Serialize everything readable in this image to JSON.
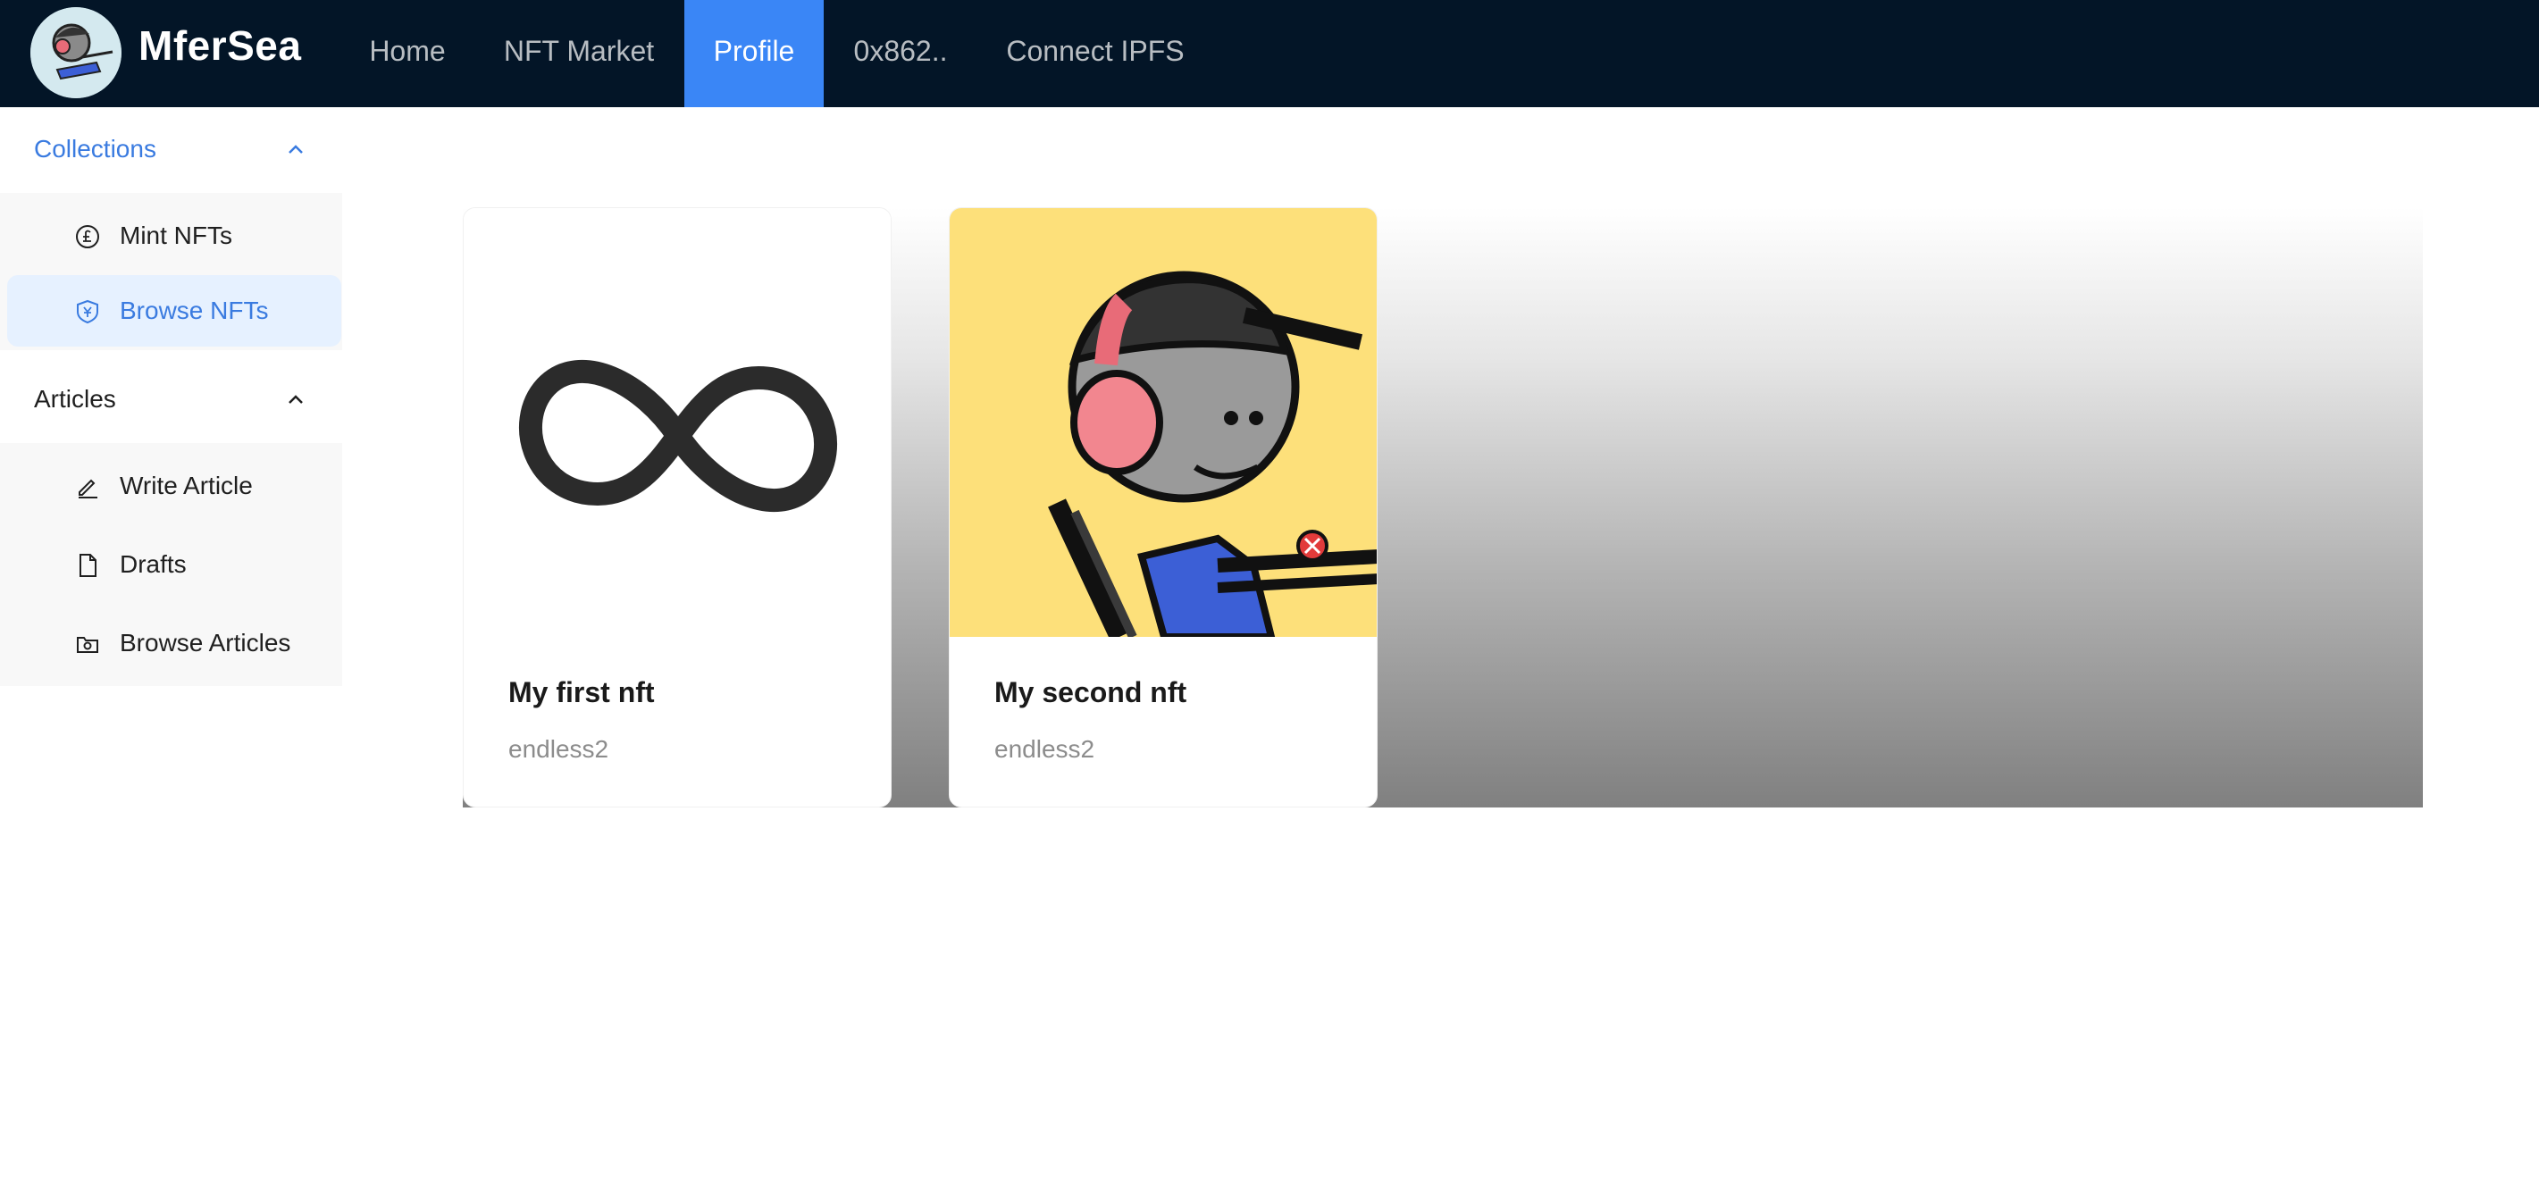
{
  "header": {
    "brand": "MferSea",
    "nav": [
      {
        "label": "Home"
      },
      {
        "label": "NFT Market"
      },
      {
        "label": "Profile"
      },
      {
        "label": "0x862.."
      },
      {
        "label": "Connect IPFS"
      }
    ],
    "active_index": 2
  },
  "sidebar": {
    "collections": {
      "label": "Collections",
      "items": [
        {
          "label": "Mint NFTs",
          "icon": "pound-coin-icon"
        },
        {
          "label": "Browse NFTs",
          "icon": "yen-shield-icon"
        }
      ],
      "selected": "Browse NFTs"
    },
    "articles": {
      "label": "Articles",
      "items": [
        {
          "label": "Write Article",
          "icon": "pencil-icon"
        },
        {
          "label": "Drafts",
          "icon": "file-icon"
        },
        {
          "label": "Browse Articles",
          "icon": "camera-folder-icon"
        }
      ]
    }
  },
  "cards": [
    {
      "title": "My first nft",
      "subtitle": "endless2",
      "art": "infinity-symbol"
    },
    {
      "title": "My second nft",
      "subtitle": "endless2",
      "art": "mfer-character"
    }
  ],
  "colors": {
    "header_bg": "#031527",
    "accent": "#3a86f6",
    "sidebar_selected_bg": "#e6f1ff",
    "sidebar_selected_text": "#3a7be0",
    "card2_bg": "#fde07a"
  }
}
